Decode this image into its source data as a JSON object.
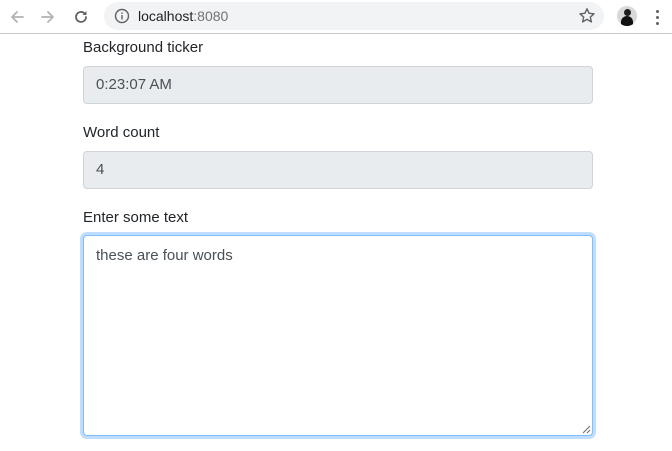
{
  "browser": {
    "url_host": "localhost",
    "url_port": ":8080",
    "icons": {
      "back": "back-arrow-icon",
      "forward": "forward-arrow-icon",
      "reload": "reload-icon",
      "info": "info-icon",
      "bookmark": "star-icon",
      "menu": "kebab-menu-icon"
    }
  },
  "form": {
    "ticker": {
      "label": "Background ticker",
      "value": "0:23:07 AM"
    },
    "word_count": {
      "label": "Word count",
      "value": "4"
    },
    "text_input": {
      "label": "Enter some text",
      "value": "these are four words"
    }
  },
  "colors": {
    "focus_border": "#80bdff",
    "readonly_bg": "#e9ecef",
    "text": "#212529"
  }
}
